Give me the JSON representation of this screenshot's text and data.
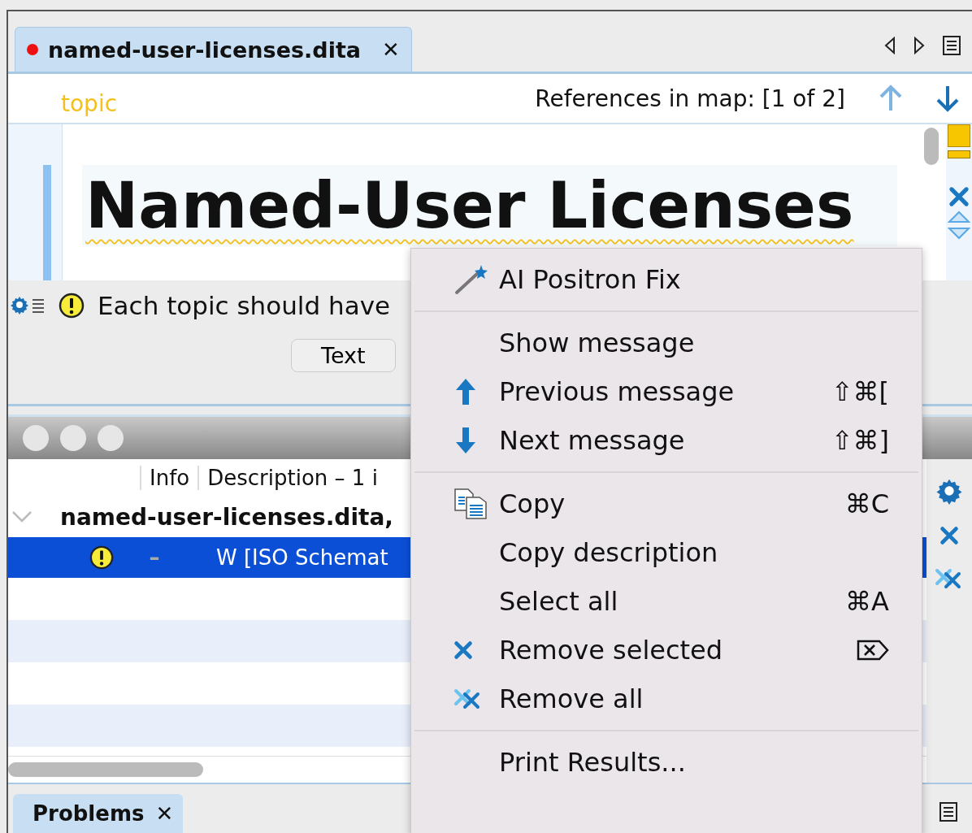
{
  "editor_tab": {
    "label": "named-user-licenses.dita",
    "modified": true,
    "close": "✕"
  },
  "breadcrumb": {
    "element": "topic",
    "references": "References in map: [1 of 2]"
  },
  "document": {
    "title": "Named-User Licenses"
  },
  "message_bar": {
    "text": "Each topic should have"
  },
  "mode_buttons": [
    {
      "label": "Text"
    }
  ],
  "results": {
    "columns": [
      "Info",
      "Description – 1 i"
    ],
    "group": {
      "label": "named-user-licenses.dita,",
      "expanded": true
    },
    "rows": [
      {
        "marker": "–",
        "description": "W [ISO Schemat",
        "selected": true
      }
    ]
  },
  "bottom_tabs": [
    {
      "label": "Problems",
      "close": "✕",
      "selected": true
    }
  ],
  "context_menu": {
    "sections": [
      [
        {
          "label": "AI Positron Fix",
          "kind": "fix"
        }
      ],
      [
        {
          "label": "Show message",
          "kind": "show"
        },
        {
          "label": "Previous message",
          "kind": "previous",
          "shortcut": "⇧⌘["
        },
        {
          "label": "Next message",
          "kind": "next",
          "shortcut": "⇧⌘]"
        }
      ],
      [
        {
          "label": "Copy",
          "kind": "copy",
          "shortcut": "⌘C"
        },
        {
          "label": "Copy description",
          "kind": "copy_description"
        },
        {
          "label": "Select all",
          "kind": "select_all",
          "shortcut": "⌘A"
        },
        {
          "label": "Remove selected",
          "kind": "remove_selected"
        },
        {
          "label": "Remove all",
          "kind": "remove_all"
        }
      ],
      [
        {
          "label": "Print Results...",
          "kind": "print"
        }
      ]
    ]
  }
}
